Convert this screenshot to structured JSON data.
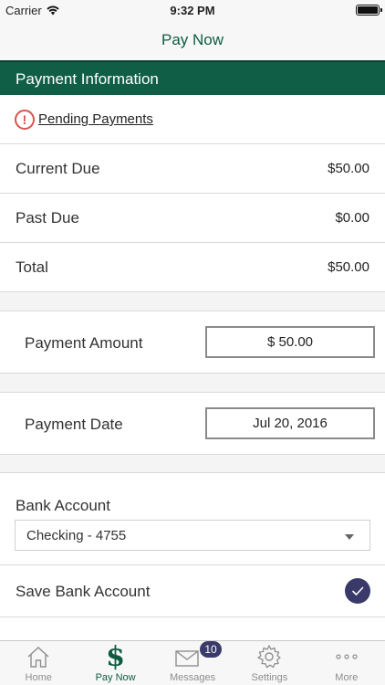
{
  "status_bar": {
    "carrier": "Carrier",
    "time": "9:32 PM"
  },
  "nav": {
    "title": "Pay Now"
  },
  "section": {
    "title": "Payment Information"
  },
  "pending": {
    "label": "Pending Payments",
    "icon": "alert-circle-icon",
    "icon_color": "#d9534f"
  },
  "amounts": [
    {
      "label": "Current Due",
      "value": "$50.00"
    },
    {
      "label": "Past Due",
      "value": "$0.00"
    },
    {
      "label": "Total",
      "value": "$50.00"
    }
  ],
  "payment_amount": {
    "label": "Payment Amount",
    "value": "$ 50.00"
  },
  "payment_date": {
    "label": "Payment Date",
    "value": "Jul 20, 2016"
  },
  "bank_account": {
    "label": "Bank Account",
    "selected": "Checking - 4755"
  },
  "save_bank": {
    "label": "Save Bank Account",
    "checked": true
  },
  "tabs": [
    {
      "label": "Home",
      "icon": "home-icon",
      "active": false
    },
    {
      "label": "Pay Now",
      "icon": "dollar-icon",
      "active": true
    },
    {
      "label": "Messages",
      "icon": "envelope-icon",
      "active": false,
      "badge": "10"
    },
    {
      "label": "Settings",
      "icon": "gear-icon",
      "active": false
    },
    {
      "label": "More",
      "icon": "more-icon",
      "active": false
    }
  ],
  "colors": {
    "brand_green": "#115e46",
    "accent_indigo": "#3a3a6a",
    "alert_red": "#d9534f"
  }
}
